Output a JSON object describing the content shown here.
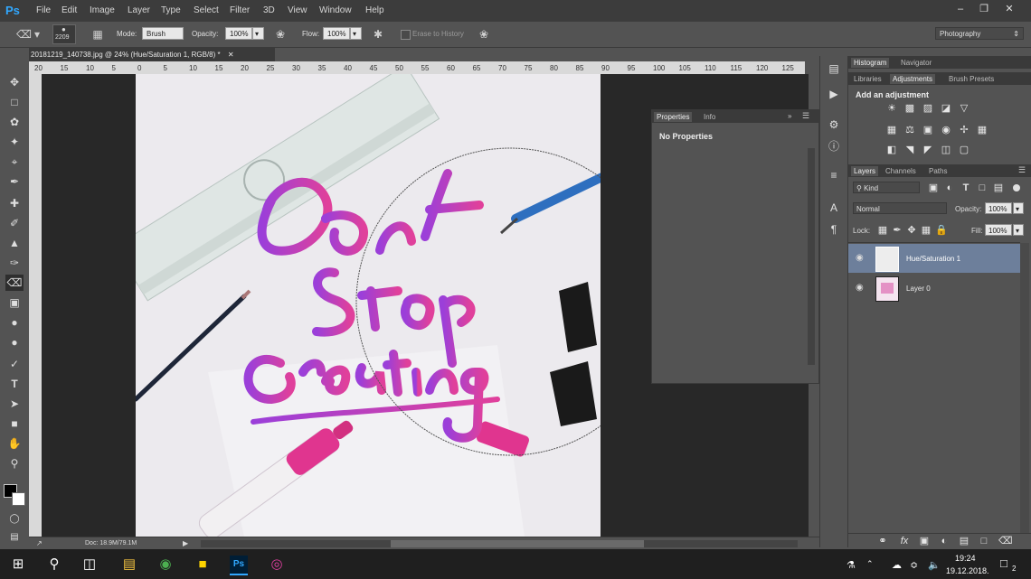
{
  "menu": {
    "app_logo": "Ps",
    "items": [
      "File",
      "Edit",
      "Image",
      "Layer",
      "Type",
      "Select",
      "Filter",
      "3D",
      "View",
      "Window",
      "Help"
    ]
  },
  "options": {
    "brush_size": "2209",
    "mode_label": "Mode:",
    "mode_value": "Brush",
    "opacity_label": "Opacity:",
    "opacity_value": "100%",
    "flow_label": "Flow:",
    "flow_value": "100%",
    "erase_history_label": "Erase to History",
    "workspace": "Photography"
  },
  "document": {
    "tab_title": "20181219_140738.jpg @ 24% (Hue/Saturation 1, RGB/8) *",
    "ruler_ticks": [
      "20",
      "15",
      "10",
      "5",
      "0",
      "5",
      "10",
      "15",
      "20",
      "25",
      "30",
      "35",
      "40",
      "45",
      "50",
      "55",
      "60",
      "65",
      "70",
      "75",
      "80",
      "85",
      "90",
      "95",
      "100",
      "105",
      "110",
      "115",
      "120",
      "125"
    ],
    "doc_info": "Doc: 18.9M/79.1M"
  },
  "properties_panel": {
    "tabs": [
      "Properties",
      "Info"
    ],
    "content": "No Properties"
  },
  "top_panel": {
    "tabs": [
      "Histogram",
      "Navigator"
    ],
    "tabs2": [
      "Libraries",
      "Adjustments",
      "Brush Presets"
    ],
    "heading": "Add an adjustment"
  },
  "layers_panel": {
    "tabs": [
      "Layers",
      "Channels",
      "Paths"
    ],
    "filter_kind": "Kind",
    "blend_mode": "Normal",
    "opacity_label": "Opacity:",
    "opacity_value": "100%",
    "lock_label": "Lock:",
    "fill_label": "Fill:",
    "fill_value": "100%",
    "layers": [
      {
        "name": "Hue/Saturation 1",
        "selected": true
      },
      {
        "name": "Layer 0",
        "selected": false
      }
    ]
  },
  "taskbar": {
    "time": "19:24",
    "date": "19.12.2018.",
    "notifications": "2"
  },
  "colors": {
    "accent": "#31a8ff",
    "selected_layer": "#6d7f9b",
    "ink_pink": "#d63a9a",
    "ink_purple": "#9b3fd9"
  }
}
